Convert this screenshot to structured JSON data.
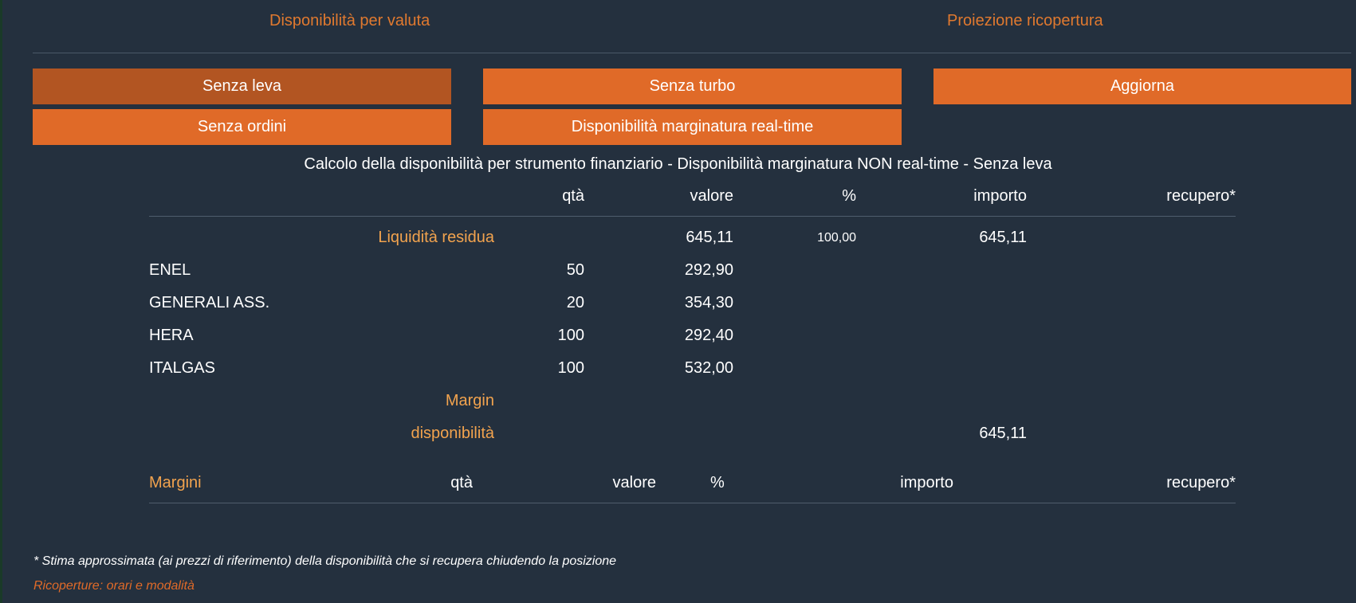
{
  "tabs": [
    "Disponibilità per valuta",
    "Proiezione ricopertura"
  ],
  "buttons": {
    "senza_leva": "Senza leva",
    "senza_turbo": "Senza turbo",
    "aggiorna": "Aggiorna",
    "senza_ordini": "Senza ordini",
    "disp_realtime": "Disponibilità marginatura real-time"
  },
  "section_title": "Calcolo della disponibilità per strumento finanziario - Disponibilità marginatura NON real-time - Senza leva",
  "table1": {
    "headers": {
      "qta": "qtà",
      "valore": "valore",
      "pct": "%",
      "importo": "importo",
      "recupero": "recupero*"
    },
    "liquidita": {
      "label": "Liquidità residua",
      "valore": "645,11",
      "pct": "100,00",
      "importo": "645,11"
    },
    "rows": [
      {
        "name": "ENEL",
        "qta": "50",
        "valore": "292,90"
      },
      {
        "name": "GENERALI ASS.",
        "qta": "20",
        "valore": "354,30"
      },
      {
        "name": "HERA",
        "qta": "100",
        "valore": "292,40"
      },
      {
        "name": "ITALGAS",
        "qta": "100",
        "valore": "532,00"
      }
    ],
    "margin_label": "Margin",
    "disponibilita": {
      "label": "disponibilità",
      "importo": "645,11"
    }
  },
  "table2": {
    "headers": {
      "margini": "Margini",
      "qta": "qtà",
      "valore": "valore",
      "pct": "%",
      "importo": "importo",
      "recupero": "recupero*"
    }
  },
  "footnote": "* Stima approssimata (ai prezzi di riferimento) della disponibilità che si recupera chiudendo la posizione",
  "link": "Ricoperture: orari e modalità"
}
